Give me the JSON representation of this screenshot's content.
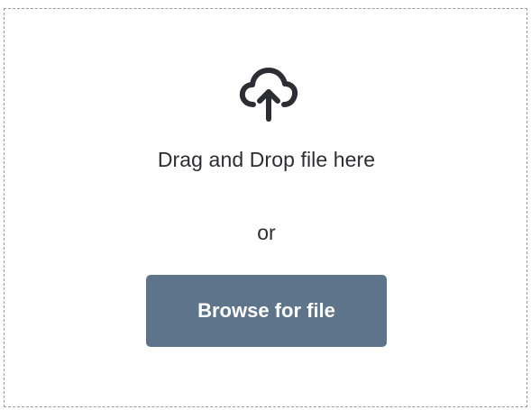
{
  "dropzone": {
    "icon": "cloud-upload-icon",
    "drag_text": "Drag and Drop file here",
    "or_text": "or",
    "browse_label": "Browse for file"
  },
  "colors": {
    "text": "#2c2e33",
    "button_bg": "#5e748b",
    "button_text": "#ffffff",
    "border": "#9a9a9a"
  }
}
